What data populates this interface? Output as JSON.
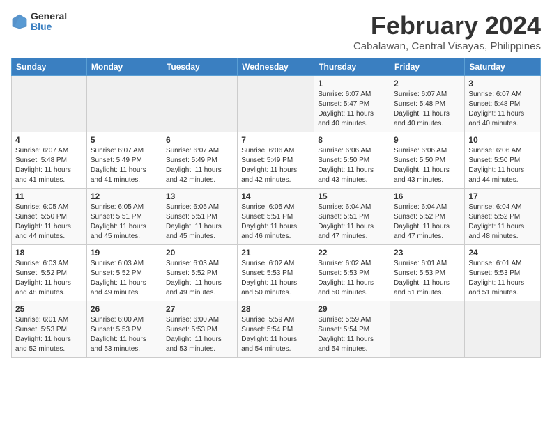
{
  "logo": {
    "general": "General",
    "blue": "Blue"
  },
  "header": {
    "month": "February 2024",
    "location": "Cabalawan, Central Visayas, Philippines"
  },
  "weekdays": [
    "Sunday",
    "Monday",
    "Tuesday",
    "Wednesday",
    "Thursday",
    "Friday",
    "Saturday"
  ],
  "weeks": [
    [
      {
        "day": "",
        "info": ""
      },
      {
        "day": "",
        "info": ""
      },
      {
        "day": "",
        "info": ""
      },
      {
        "day": "",
        "info": ""
      },
      {
        "day": "1",
        "info": "Sunrise: 6:07 AM\nSunset: 5:47 PM\nDaylight: 11 hours\nand 40 minutes."
      },
      {
        "day": "2",
        "info": "Sunrise: 6:07 AM\nSunset: 5:48 PM\nDaylight: 11 hours\nand 40 minutes."
      },
      {
        "day": "3",
        "info": "Sunrise: 6:07 AM\nSunset: 5:48 PM\nDaylight: 11 hours\nand 40 minutes."
      }
    ],
    [
      {
        "day": "4",
        "info": "Sunrise: 6:07 AM\nSunset: 5:48 PM\nDaylight: 11 hours\nand 41 minutes."
      },
      {
        "day": "5",
        "info": "Sunrise: 6:07 AM\nSunset: 5:49 PM\nDaylight: 11 hours\nand 41 minutes."
      },
      {
        "day": "6",
        "info": "Sunrise: 6:07 AM\nSunset: 5:49 PM\nDaylight: 11 hours\nand 42 minutes."
      },
      {
        "day": "7",
        "info": "Sunrise: 6:06 AM\nSunset: 5:49 PM\nDaylight: 11 hours\nand 42 minutes."
      },
      {
        "day": "8",
        "info": "Sunrise: 6:06 AM\nSunset: 5:50 PM\nDaylight: 11 hours\nand 43 minutes."
      },
      {
        "day": "9",
        "info": "Sunrise: 6:06 AM\nSunset: 5:50 PM\nDaylight: 11 hours\nand 43 minutes."
      },
      {
        "day": "10",
        "info": "Sunrise: 6:06 AM\nSunset: 5:50 PM\nDaylight: 11 hours\nand 44 minutes."
      }
    ],
    [
      {
        "day": "11",
        "info": "Sunrise: 6:05 AM\nSunset: 5:50 PM\nDaylight: 11 hours\nand 44 minutes."
      },
      {
        "day": "12",
        "info": "Sunrise: 6:05 AM\nSunset: 5:51 PM\nDaylight: 11 hours\nand 45 minutes."
      },
      {
        "day": "13",
        "info": "Sunrise: 6:05 AM\nSunset: 5:51 PM\nDaylight: 11 hours\nand 45 minutes."
      },
      {
        "day": "14",
        "info": "Sunrise: 6:05 AM\nSunset: 5:51 PM\nDaylight: 11 hours\nand 46 minutes."
      },
      {
        "day": "15",
        "info": "Sunrise: 6:04 AM\nSunset: 5:51 PM\nDaylight: 11 hours\nand 47 minutes."
      },
      {
        "day": "16",
        "info": "Sunrise: 6:04 AM\nSunset: 5:52 PM\nDaylight: 11 hours\nand 47 minutes."
      },
      {
        "day": "17",
        "info": "Sunrise: 6:04 AM\nSunset: 5:52 PM\nDaylight: 11 hours\nand 48 minutes."
      }
    ],
    [
      {
        "day": "18",
        "info": "Sunrise: 6:03 AM\nSunset: 5:52 PM\nDaylight: 11 hours\nand 48 minutes."
      },
      {
        "day": "19",
        "info": "Sunrise: 6:03 AM\nSunset: 5:52 PM\nDaylight: 11 hours\nand 49 minutes."
      },
      {
        "day": "20",
        "info": "Sunrise: 6:03 AM\nSunset: 5:52 PM\nDaylight: 11 hours\nand 49 minutes."
      },
      {
        "day": "21",
        "info": "Sunrise: 6:02 AM\nSunset: 5:53 PM\nDaylight: 11 hours\nand 50 minutes."
      },
      {
        "day": "22",
        "info": "Sunrise: 6:02 AM\nSunset: 5:53 PM\nDaylight: 11 hours\nand 50 minutes."
      },
      {
        "day": "23",
        "info": "Sunrise: 6:01 AM\nSunset: 5:53 PM\nDaylight: 11 hours\nand 51 minutes."
      },
      {
        "day": "24",
        "info": "Sunrise: 6:01 AM\nSunset: 5:53 PM\nDaylight: 11 hours\nand 51 minutes."
      }
    ],
    [
      {
        "day": "25",
        "info": "Sunrise: 6:01 AM\nSunset: 5:53 PM\nDaylight: 11 hours\nand 52 minutes."
      },
      {
        "day": "26",
        "info": "Sunrise: 6:00 AM\nSunset: 5:53 PM\nDaylight: 11 hours\nand 53 minutes."
      },
      {
        "day": "27",
        "info": "Sunrise: 6:00 AM\nSunset: 5:53 PM\nDaylight: 11 hours\nand 53 minutes."
      },
      {
        "day": "28",
        "info": "Sunrise: 5:59 AM\nSunset: 5:54 PM\nDaylight: 11 hours\nand 54 minutes."
      },
      {
        "day": "29",
        "info": "Sunrise: 5:59 AM\nSunset: 5:54 PM\nDaylight: 11 hours\nand 54 minutes."
      },
      {
        "day": "",
        "info": ""
      },
      {
        "day": "",
        "info": ""
      }
    ]
  ]
}
